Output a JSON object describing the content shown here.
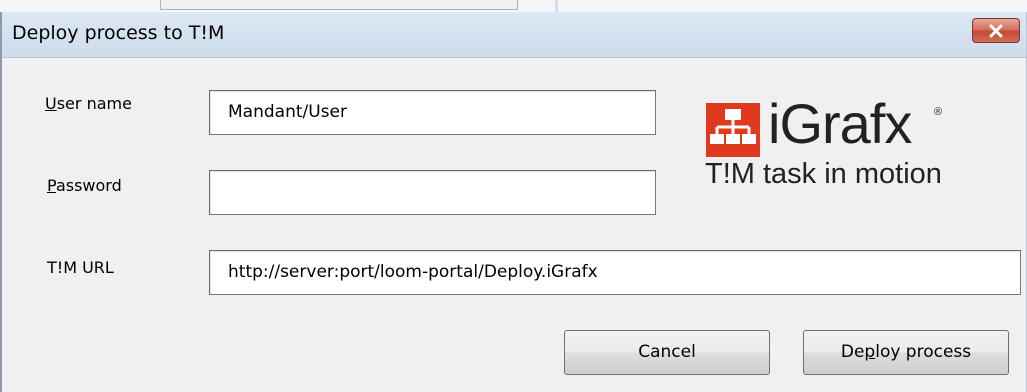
{
  "window": {
    "title": "Deploy process to T!M",
    "close_icon": "close-icon"
  },
  "form": {
    "username": {
      "label_access": "U",
      "label_rest": "ser name",
      "value": "Mandant/User"
    },
    "password": {
      "label_access": "P",
      "label_rest": "assword",
      "value": ""
    },
    "url": {
      "label": "T!M URL",
      "value": "http://server:port/loom-portal/Deploy.iGrafx"
    }
  },
  "logo": {
    "brand": "iGrafx",
    "registered": "®",
    "tagline": "T!M task in motion",
    "mark_color": "#e03a1e"
  },
  "buttons": {
    "cancel": "Cancel",
    "deploy_pre": "De",
    "deploy_access": "p",
    "deploy_post": "loy process"
  },
  "colors": {
    "titlebar": "#d6e3f1",
    "dialog_bg": "#f0f0f0",
    "close_red": "#c9503b"
  }
}
